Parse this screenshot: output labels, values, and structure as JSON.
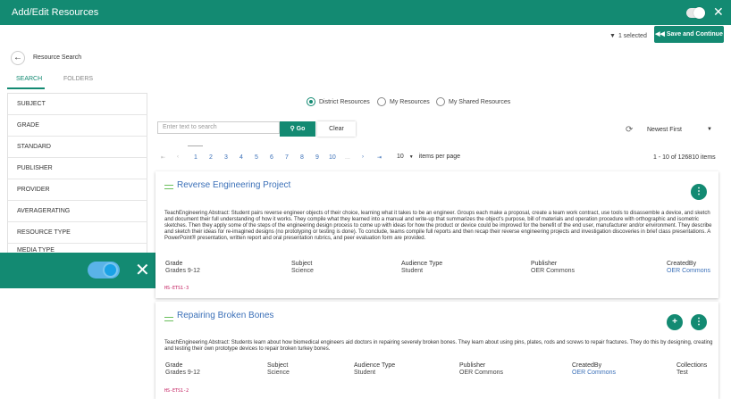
{
  "header": {
    "title": "Add/Edit Resources",
    "close_icon": "close-icon"
  },
  "toolbar": {
    "selected_text": "1 selected",
    "save_label": "Save and Continue"
  },
  "nav": {
    "back_label": "Resource Search",
    "tabs": [
      {
        "label": "SEARCH",
        "active": true
      },
      {
        "label": "FOLDERS",
        "active": false
      }
    ]
  },
  "sidebar": {
    "items": [
      {
        "label": "SUBJECT"
      },
      {
        "label": "GRADE"
      },
      {
        "label": "STANDARD"
      },
      {
        "label": "PUBLISHER"
      },
      {
        "label": "PROVIDER"
      },
      {
        "label": "AVERAGERATING"
      },
      {
        "label": "RESOURCE TYPE"
      },
      {
        "label": "MEDIA TYPE"
      }
    ]
  },
  "scope": {
    "options": [
      {
        "label": "District Resources",
        "checked": true
      },
      {
        "label": "My Resources",
        "checked": false
      },
      {
        "label": "My Shared Resources",
        "checked": false
      }
    ]
  },
  "search": {
    "placeholder": "Enter text to search",
    "go_label": "Go",
    "clear_label": "Clear"
  },
  "sort": {
    "selected": "Newest First"
  },
  "pagination": {
    "pages": [
      "1",
      "2",
      "3",
      "4",
      "5",
      "6",
      "7",
      "8",
      "9",
      "10"
    ],
    "ellipsis": "...",
    "per_page_value": "10",
    "per_page_label": "items per page",
    "range_text": "1 - 10 of 126810 items"
  },
  "results": [
    {
      "title": "Reverse Engineering Project",
      "abstract": "TeachEngineering Abstract: Student pairs reverse engineer objects of their choice, learning what it takes to be an engineer. Groups each make a proposal, create a team work contract, use tools to disassemble a device, and sketch and document their full understanding of how it works. They compile what they learned into a manual and write-up that summarizes the object's purpose, bill of materials and operation procedure with orthographic and isometric sketches. Then they apply some of the steps of the engineering design process to come up with ideas for how the product or device could be improved for the benefit of the end user, manufacturer and/or environment. They describe and sketch their ideas for re-imagined designs (no prototyping or testing is done). To conclude, teams compile full reports and then recap their reverse engineering projects and investigation discoveries in brief class presentations. A PowerPoint® presentation, written report and oral presentation rubrics, and peer evaluation form are provided.",
      "grade_label": "Grade",
      "grade": "Grades 9-12",
      "subject_label": "Subject",
      "subject": "Science",
      "audience_label": "Audience Type",
      "audience": "Student",
      "publisher_label": "Publisher",
      "publisher": "OER Commons",
      "createdby_label": "CreatedBy",
      "createdby": "OER Commons",
      "tag": "HS-ETS1-3"
    },
    {
      "title": "Repairing Broken Bones",
      "abstract": "TeachEngineering Abstract: Students learn about how biomedical engineers aid doctors in repairing severely broken bones. They learn about using pins, plates, rods and screws to repair fractures. They do this by designing, creating and testing their own prototype devices to repair broken turkey bones.",
      "grade_label": "Grade",
      "grade": "Grades 9-12",
      "subject_label": "Subject",
      "subject": "Science",
      "audience_label": "Audience Type",
      "audience": "Student",
      "publisher_label": "Publisher",
      "publisher": "OER Commons",
      "createdby_label": "CreatedBy",
      "createdby": "OER Commons",
      "collections_label": "Collections",
      "collections": "Test",
      "tag": "HS-ETS1-2"
    }
  ],
  "colors": {
    "brand": "#138a72",
    "link": "#3b70b8",
    "tag": "#c2185b"
  }
}
